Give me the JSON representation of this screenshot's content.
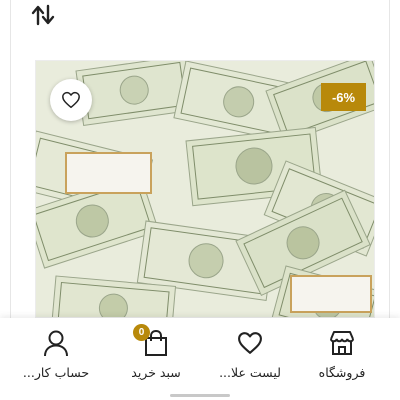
{
  "product": {
    "discount_badge": "-6%",
    "image_description": "stack of US hundred-dollar bills",
    "badge_color": "#b8890a"
  },
  "toolbar": {
    "sort_icon": "sort-arrows-icon"
  },
  "bottom_nav": {
    "items": [
      {
        "label": "فروشگاه",
        "icon": "store-icon"
      },
      {
        "label": "لیست علا...",
        "icon": "heart-icon"
      },
      {
        "label": "سبد خرید",
        "icon": "shopping-bag-icon",
        "badge": "0"
      },
      {
        "label": "حساب کار...",
        "icon": "user-icon"
      }
    ]
  },
  "accent_color": "#b8890a"
}
